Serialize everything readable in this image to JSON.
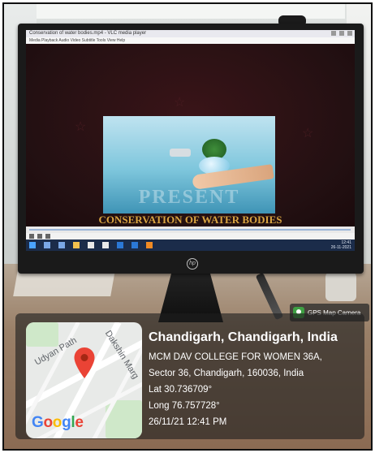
{
  "screen": {
    "window_title": "Conservation of water bodies.mp4 - VLC media player",
    "menu": "Media  Playback  Audio  Video  Subtitle  Tools  View  Help",
    "slide_title": "CONSERVATION OF WATER BODIES",
    "slide_watermark": "PRESENT",
    "taskbar_clock": "12:41\n26-11-2021",
    "monitor_logo": "hp"
  },
  "gps": {
    "badge_label": "GPS Map Camera",
    "map_labels": {
      "street1": "Udyan Path",
      "street2": "Dakshin Marg"
    },
    "google_letters": [
      {
        "ch": "G",
        "color": "#4285F4"
      },
      {
        "ch": "o",
        "color": "#EA4335"
      },
      {
        "ch": "o",
        "color": "#FBBC05"
      },
      {
        "ch": "g",
        "color": "#4285F4"
      },
      {
        "ch": "l",
        "color": "#34A853"
      },
      {
        "ch": "e",
        "color": "#EA4335"
      }
    ],
    "title": "Chandigarh, Chandigarh, India",
    "address_line1": "MCM DAV COLLEGE FOR WOMEN 36A,",
    "address_line2": "Sector 36, Chandigarh, 160036, India",
    "lat": "Lat 30.736709°",
    "long": "Long 76.757728°",
    "datetime": "26/11/21 12:41 PM",
    "pin_color": "#EA4335"
  }
}
